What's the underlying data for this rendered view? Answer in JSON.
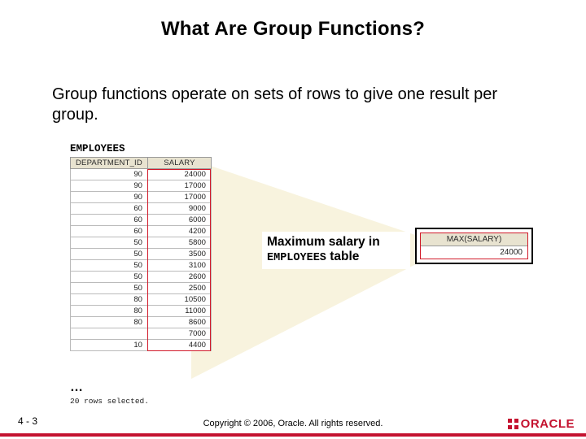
{
  "title": "What Are Group Functions?",
  "subtitle": "Group functions operate on sets of rows to give one result per group.",
  "employees": {
    "label": "EMPLOYEES",
    "headers": {
      "dept": "DEPARTMENT_ID",
      "sal": "SALARY"
    },
    "rows": [
      {
        "dept": "90",
        "sal": "24000"
      },
      {
        "dept": "90",
        "sal": "17000"
      },
      {
        "dept": "90",
        "sal": "17000"
      },
      {
        "dept": "60",
        "sal": "9000"
      },
      {
        "dept": "60",
        "sal": "6000"
      },
      {
        "dept": "60",
        "sal": "4200"
      },
      {
        "dept": "50",
        "sal": "5800"
      },
      {
        "dept": "50",
        "sal": "3500"
      },
      {
        "dept": "50",
        "sal": "3100"
      },
      {
        "dept": "50",
        "sal": "2600"
      },
      {
        "dept": "50",
        "sal": "2500"
      },
      {
        "dept": "80",
        "sal": "10500"
      },
      {
        "dept": "80",
        "sal": "11000"
      },
      {
        "dept": "80",
        "sal": "8600"
      },
      {
        "dept": "",
        "sal": "7000"
      },
      {
        "dept": "10",
        "sal": "4400"
      }
    ],
    "ellipsis": "…",
    "rows_selected": "20 rows selected."
  },
  "callout": {
    "line1": "Maximum salary in",
    "table_word": "EMPLOYEES",
    "suffix": " table"
  },
  "result": {
    "header": "MAX(SALARY)",
    "value": "24000"
  },
  "footer": {
    "slide_num": "4 - 3",
    "copyright": "Copyright © 2006, Oracle. All rights reserved.",
    "logo_text": "ORACLE"
  }
}
